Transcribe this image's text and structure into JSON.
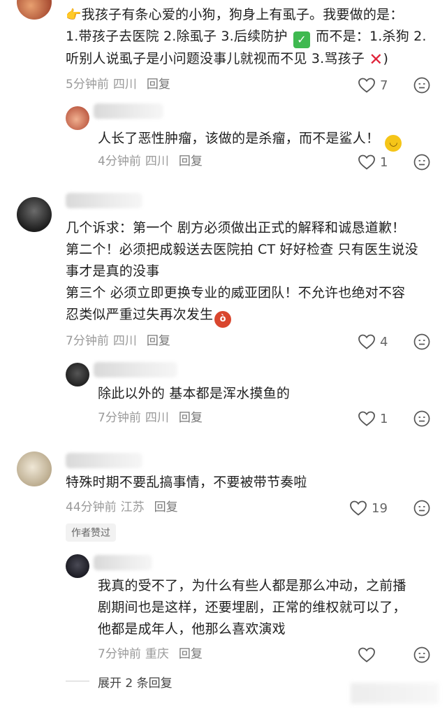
{
  "comments": [
    {
      "text_line1": "我孩子有条心爱的小狗，狗身上有虱子。我要做的是：",
      "text_line2a": "1.带孩子去医院 2.除虱子 3.后续防护",
      "text_line2b": "而不是：1.杀狗 2.",
      "text_line3a": "听别人说虱子是小问题没事儿就视而不见  3.骂孩子",
      "text_line3b": ")",
      "time": "5分钟前",
      "location": "四川",
      "reply": "回复",
      "likes": "7"
    },
    {
      "text": "人长了恶性肿瘤，该做的是杀瘤，而不是鲨人！",
      "time": "4分钟前",
      "location": "四川",
      "reply": "回复",
      "likes": "1"
    },
    {
      "line1": "几个诉求：第一个 剧方必须做出正式的解释和诚恳道歉！",
      "line2": "第二个！必须把成毅送去医院拍 CT 好好检查 只有医生说没",
      "line3": "事才是真的没事",
      "line4": "第三个 必须立即更换专业的威亚团队！不允许也绝对不容",
      "line5": "忍类似严重过失再次发生",
      "time": "7分钟前",
      "location": "四川",
      "reply": "回复",
      "likes": "4"
    },
    {
      "text": "除此以外的 基本都是浑水摸鱼的",
      "time": "7分钟前",
      "location": "四川",
      "reply": "回复",
      "likes": "1"
    },
    {
      "text": "特殊时期不要乱搞事情，不要被带节奏啦",
      "time": "44分钟前",
      "location": "江苏",
      "reply": "回复",
      "likes": "19",
      "badge": "作者赞过"
    },
    {
      "line1": "我真的受不了，为什么有些人都是那么冲动，之前播",
      "line2": "剧期间也是这样，还要埋剧，正常的维权就可以了，",
      "line3": "他都是成年人，他那么喜欢演戏",
      "time": "7分钟前",
      "location": "重庆",
      "reply": "回复"
    }
  ],
  "expand_replies": "展开 2 条回复",
  "icons": [
    "pointing-hand-icon",
    "check-mark-icon",
    "cross-mark-icon",
    "smile-icon",
    "devil-face-icon",
    "heart-icon",
    "emoji-face-icon"
  ],
  "colors": {
    "meta": "#9a9a9a",
    "check_green": "#3fb950",
    "cross_red": "#e0243a",
    "devil": "#d9462e"
  }
}
